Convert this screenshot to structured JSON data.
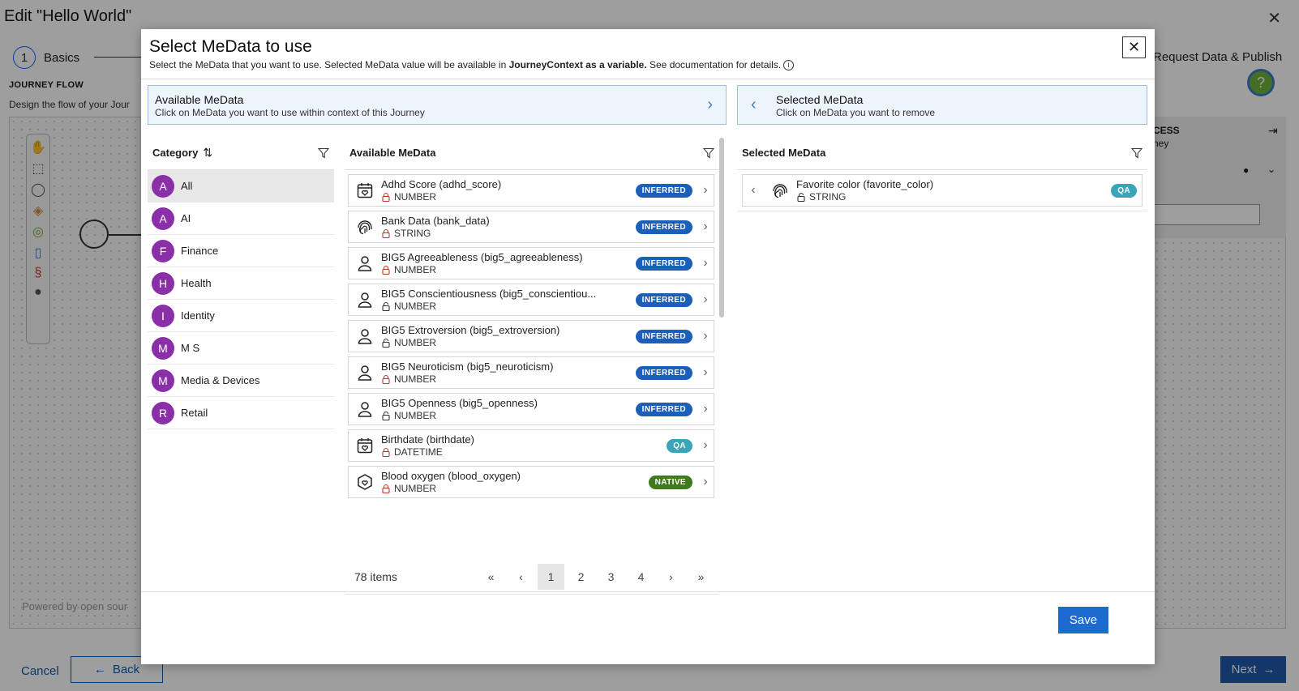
{
  "background": {
    "title": "Edit \"Hello World\"",
    "close_glyph": "✕",
    "step_number": "1",
    "step_label": "Basics",
    "step_right_label": "Request Data & Publish",
    "help_glyph": "?",
    "flow_heading": "JOURNEY FLOW",
    "flow_desc": "Design the flow of your Jour",
    "powered_by": "Powered by open sour",
    "panel_title": "CESS",
    "panel_sub": "ney",
    "cancel_label": "Cancel",
    "back_label": "Back",
    "next_label": "Next"
  },
  "modal": {
    "title": "Select MeData to use",
    "subtitle_prefix": "Select the MeData that you want to use. Selected MeData value will be available in ",
    "subtitle_bold": "JourneyContext as a variable.",
    "subtitle_suffix": "  See documentation for details.",
    "close_glyph": "✕",
    "save_label": "Save"
  },
  "available_header": {
    "title": "Available MeData",
    "subtitle": "Click on MeData you want to use within context of this Journey"
  },
  "selected_header": {
    "title": "Selected MeData",
    "subtitle": "Click on MeData you want to remove"
  },
  "category": {
    "header": "Category",
    "sort_glyph": "⇅",
    "items": [
      {
        "letter": "A",
        "label": "All"
      },
      {
        "letter": "A",
        "label": "AI"
      },
      {
        "letter": "F",
        "label": "Finance"
      },
      {
        "letter": "H",
        "label": "Health"
      },
      {
        "letter": "I",
        "label": "Identity"
      },
      {
        "letter": "M",
        "label": "M S"
      },
      {
        "letter": "M",
        "label": "Media & Devices"
      },
      {
        "letter": "R",
        "label": "Retail"
      }
    ]
  },
  "available": {
    "header": "Available MeData",
    "items": [
      {
        "name": "Adhd Score (adhd_score)",
        "type": "NUMBER",
        "badge": "INFERRED",
        "icon": "calendar-heart-icon",
        "locked": true
      },
      {
        "name": "Bank Data (bank_data)",
        "type": "STRING",
        "badge": "INFERRED",
        "icon": "fingerprint-icon",
        "locked": true
      },
      {
        "name": "BIG5 Agreeableness (big5_agreeableness)",
        "type": "NUMBER",
        "badge": "INFERRED",
        "icon": "person-icon",
        "locked": true
      },
      {
        "name": "BIG5 Conscientiousness (big5_conscientiou...",
        "type": "NUMBER",
        "badge": "INFERRED",
        "icon": "person-icon",
        "locked": false
      },
      {
        "name": "BIG5 Extroversion (big5_extroversion)",
        "type": "NUMBER",
        "badge": "INFERRED",
        "icon": "person-icon",
        "locked": false
      },
      {
        "name": "BIG5 Neuroticism (big5_neuroticism)",
        "type": "NUMBER",
        "badge": "INFERRED",
        "icon": "person-icon",
        "locked": true
      },
      {
        "name": "BIG5 Openness (big5_openness)",
        "type": "NUMBER",
        "badge": "INFERRED",
        "icon": "person-icon",
        "locked": false
      },
      {
        "name": "Birthdate (birthdate)",
        "type": "DATETIME",
        "badge": "QA",
        "icon": "calendar-heart-icon",
        "locked": true
      },
      {
        "name": "Blood oxygen (blood_oxygen)",
        "type": "NUMBER",
        "badge": "NATIVE",
        "icon": "shield-heart-icon",
        "locked": true
      }
    ]
  },
  "pagination": {
    "count": "78 items",
    "first": "«",
    "prev": "‹",
    "pages": [
      "1",
      "2",
      "3",
      "4"
    ],
    "active_page": "1",
    "next": "›",
    "last": "»"
  },
  "selected": {
    "header": "Selected MeData",
    "items": [
      {
        "name": "Favorite color (favorite_color)",
        "type": "STRING",
        "badge": "QA",
        "icon": "fingerprint-icon",
        "locked": false
      }
    ]
  },
  "colors": {
    "inferred": "#1c5fb8",
    "qa": "#3aa4b8",
    "native": "#3f7a1e",
    "category_avatar": "#8a2fa8",
    "primary": "#1d6bd0"
  }
}
